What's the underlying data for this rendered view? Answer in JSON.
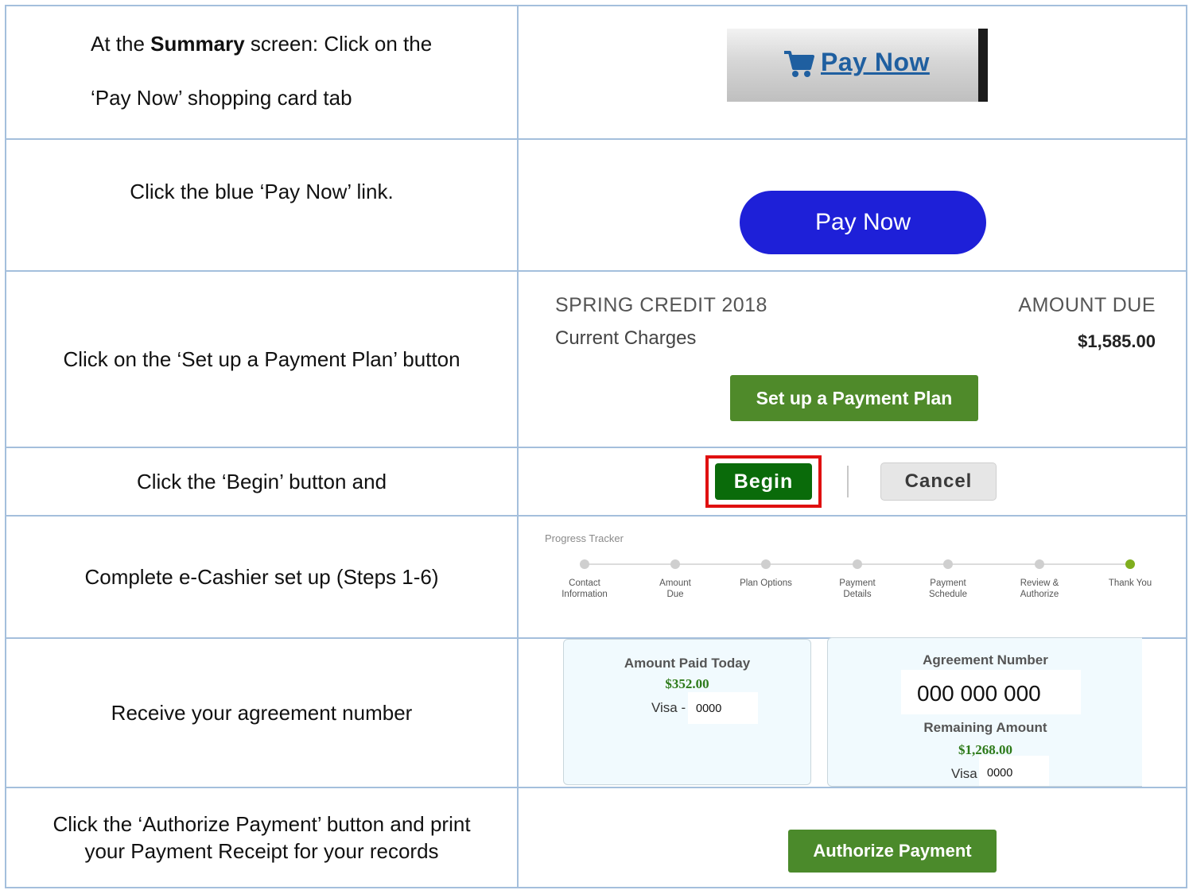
{
  "rows": {
    "r1": {
      "instruction_prefix": "At the ",
      "instruction_bold": "Summary",
      "instruction_suffix": " screen: Click on the",
      "instruction_line2": "‘Pay Now’ shopping card tab",
      "tab_label": "Pay Now"
    },
    "r2": {
      "instruction": "Click the blue ‘Pay Now’ link.",
      "button_label": "Pay Now",
      "button_color": "#1e20d8"
    },
    "r3": {
      "instruction": "Click on the ‘Set up a Payment Plan’ button",
      "term": "SPRING CREDIT 2018",
      "amount_due_header": "AMOUNT DUE",
      "charges_label": "Current Charges",
      "amount": "$1,585.00",
      "button_label": "Set up a Payment Plan",
      "button_color": "#4f8a2a"
    },
    "r4": {
      "instruction": "Click the ‘Begin’ button and",
      "begin_label": "Begin",
      "cancel_label": "Cancel",
      "highlight_color": "#e01010"
    },
    "r5": {
      "instruction": "Complete e-Cashier set up (Steps 1-6)",
      "tracker_title": "Progress Tracker",
      "steps": [
        {
          "l1": "Contact",
          "l2": "Information"
        },
        {
          "l1": "Amount",
          "l2": "Due"
        },
        {
          "l1": "Plan Options",
          "l2": ""
        },
        {
          "l1": "Payment",
          "l2": "Details"
        },
        {
          "l1": "Payment",
          "l2": "Schedule"
        },
        {
          "l1": "Review &",
          "l2": "Authorize"
        },
        {
          "l1": "Thank You",
          "l2": ""
        }
      ],
      "active_step": "Thank You"
    },
    "r6": {
      "instruction": "Receive your agreement number",
      "paid_title": "Amount Paid Today",
      "paid_amount": "$352.00",
      "paid_card_label": "Visa -",
      "paid_card_digits": "0000",
      "agreement_title": "Agreement Number",
      "agreement_number": "000 000 000",
      "remaining_title": "Remaining Amount",
      "remaining_amount": "$1,268.00",
      "remaining_card_label": "Visa",
      "remaining_card_digits": "0000"
    },
    "r7": {
      "instruction_line1": "Click the ‘Authorize Payment’ button and print",
      "instruction_line2": "your Payment Receipt for your records",
      "button_label": "Authorize Payment"
    }
  },
  "colors": {
    "table_border": "#a4bfdc",
    "money_green": "#2d7a19",
    "tracker_active": "#7fae1e"
  }
}
